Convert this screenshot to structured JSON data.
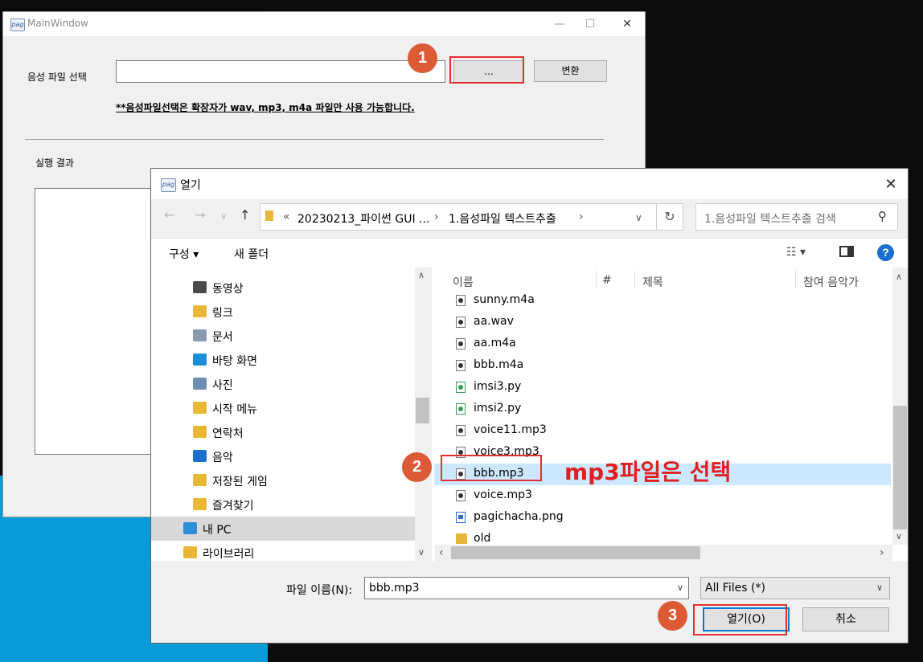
{
  "main_window": {
    "title": "MainWindow",
    "app_icon_text": "pag",
    "minimize": "—",
    "maximize": "☐",
    "close": "✕",
    "file_label": "음성 파일 선택",
    "file_input_value": "",
    "browse_label": "...",
    "convert_label": "변환",
    "note": "**음성파일선택은 확장자가 wav, mp3, m4a 파일만 사용 가능합니다.",
    "result_label": "실행 결과"
  },
  "markers": [
    "1",
    "2",
    "3"
  ],
  "annotation": "mp3파일은 선택",
  "dialog": {
    "title": "열기",
    "close": "✕",
    "nav": {
      "back": "←",
      "forward": "→",
      "recent": "∨",
      "up": "↑"
    },
    "address": {
      "prefix": "«",
      "crumbs": [
        "20230213_파이썬 GUI ...",
        "1.음성파일 텍스트추출"
      ],
      "sep": "›",
      "dropdown": "∨"
    },
    "refresh": "↻",
    "search_placeholder": "1.음성파일 텍스트추출 검색",
    "toolbar": {
      "organize": "구성 ▾",
      "new_folder": "새 폴더",
      "view": "☷ ▾",
      "help": "?"
    },
    "nav_items": [
      {
        "label": "동영상",
        "color": "#4a4a4a"
      },
      {
        "label": "링크",
        "color": "#e8b738"
      },
      {
        "label": "문서",
        "color": "#8a9ab0"
      },
      {
        "label": "바탕 화면",
        "color": "#1a8fd8"
      },
      {
        "label": "사진",
        "color": "#6a8fb0"
      },
      {
        "label": "시작 메뉴",
        "color": "#e8b738"
      },
      {
        "label": "연락처",
        "color": "#e8b738"
      },
      {
        "label": "음악",
        "color": "#1a6fd0"
      },
      {
        "label": "저장된 게임",
        "color": "#e8b738"
      },
      {
        "label": "즐겨찾기",
        "color": "#e8b738"
      },
      {
        "label": "내 PC",
        "color": "#2d8fd8"
      },
      {
        "label": "라이브러리",
        "color": "#e8b738"
      }
    ],
    "columns": [
      "이름",
      "#",
      "제목",
      "참여 음악가"
    ],
    "files": [
      {
        "name": "sunny.m4a",
        "kind": "audio"
      },
      {
        "name": "aa.wav",
        "kind": "audio"
      },
      {
        "name": "aa.m4a",
        "kind": "audio"
      },
      {
        "name": "bbb.m4a",
        "kind": "audio"
      },
      {
        "name": "imsi3.py",
        "kind": "py"
      },
      {
        "name": "imsi2.py",
        "kind": "py"
      },
      {
        "name": "voice11.mp3",
        "kind": "audio"
      },
      {
        "name": "voice3.mp3",
        "kind": "audio"
      },
      {
        "name": "bbb.mp3",
        "kind": "audio"
      },
      {
        "name": "voice.mp3",
        "kind": "audio"
      },
      {
        "name": "pagichacha.png",
        "kind": "png"
      },
      {
        "name": "old",
        "kind": "dir"
      }
    ],
    "selected_file": "bbb.mp3",
    "filename_label": "파일 이름(N):",
    "filename_value": "bbb.mp3",
    "filetype_value": "All Files (*)",
    "open_label": "열기(O)",
    "cancel_label": "취소",
    "scroll": {
      "up": "∧",
      "down": "∨",
      "left": "‹",
      "right": "›"
    }
  }
}
